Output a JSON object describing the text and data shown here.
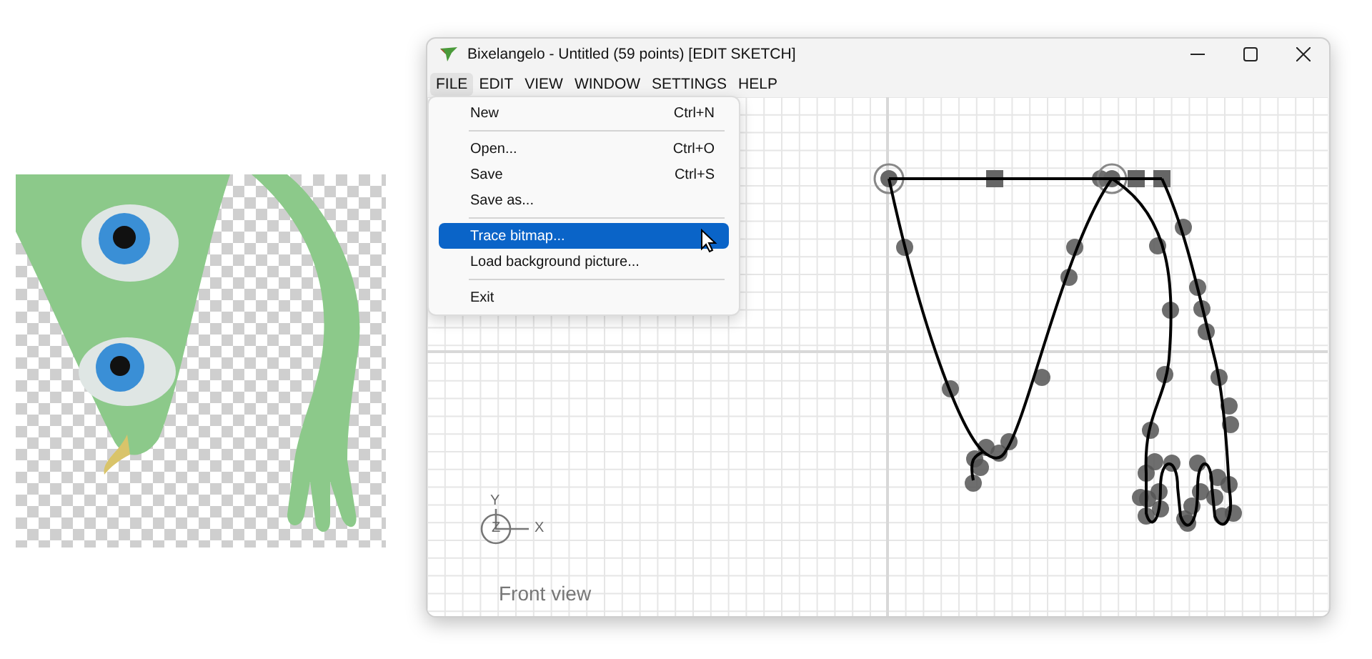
{
  "window": {
    "title": "Bixelangelo - Untitled (59 points) [EDIT SKETCH]"
  },
  "menu_bar": [
    {
      "label": "FILE",
      "selected": true
    },
    {
      "label": "EDIT",
      "selected": false
    },
    {
      "label": "VIEW",
      "selected": false
    },
    {
      "label": "WINDOW",
      "selected": false
    },
    {
      "label": "SETTINGS",
      "selected": false
    },
    {
      "label": "HELP",
      "selected": false
    }
  ],
  "file_menu": [
    {
      "kind": "item",
      "label": "New",
      "shortcut": "Ctrl+N",
      "selected": false
    },
    {
      "kind": "separator"
    },
    {
      "kind": "item",
      "label": "Open...",
      "shortcut": "Ctrl+O",
      "selected": false
    },
    {
      "kind": "item",
      "label": "Save",
      "shortcut": "Ctrl+S",
      "selected": false
    },
    {
      "kind": "item",
      "label": "Save as...",
      "selected": false
    },
    {
      "kind": "separator"
    },
    {
      "kind": "item",
      "label": "Trace bitmap...",
      "selected": true
    },
    {
      "kind": "item",
      "label": "Load background picture...",
      "selected": false
    },
    {
      "kind": "separator"
    },
    {
      "kind": "item",
      "label": "Exit",
      "selected": false
    }
  ],
  "canvas": {
    "axis_labels": {
      "y": "Y",
      "z": "Z",
      "x": "X"
    },
    "view_label": "Front view"
  }
}
